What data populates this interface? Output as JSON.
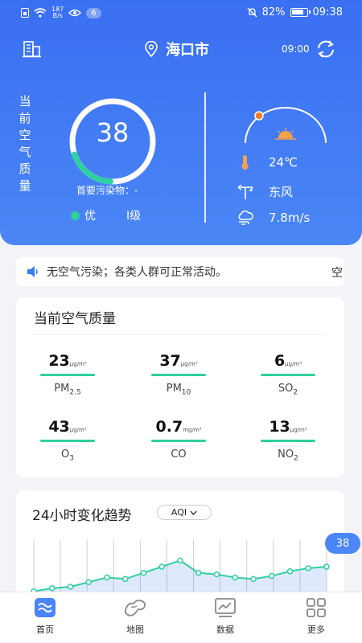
{
  "status_bar": {
    "speed_top": "187",
    "speed_bottom": "B/s",
    "notif_count": "6",
    "battery": "82%",
    "time": "09:38"
  },
  "header": {
    "city": "海口市",
    "update_time": "09:00"
  },
  "aqi": {
    "label_chars": [
      "当",
      "前",
      "空",
      "气",
      "质",
      "量"
    ],
    "value": "38",
    "progress": 0.19,
    "primary_pollutant": "首要污染物：-",
    "level_name": "优",
    "level_grade": "I级"
  },
  "weather": {
    "temperature": "24℃",
    "wind_direction": "东风",
    "wind_speed": "7.8m/s"
  },
  "notice": {
    "text": "无空气污染；各类人群可正常活动。",
    "tail": "空"
  },
  "current_card": {
    "title": "当前空气质量",
    "metrics": [
      {
        "value": "23",
        "unit": "μg/m³",
        "name": "PM",
        "sub": "2.5"
      },
      {
        "value": "37",
        "unit": "μg/m³",
        "name": "PM",
        "sub": "10"
      },
      {
        "value": "6",
        "unit": "μg/m³",
        "name": "SO",
        "sub": "2"
      },
      {
        "value": "43",
        "unit": "μg/m³",
        "name": "O",
        "sub": "3"
      },
      {
        "value": "0.7",
        "unit": "mg/m³",
        "name": "CO",
        "sub": ""
      },
      {
        "value": "13",
        "unit": "μg/m³",
        "name": "NO",
        "sub": "2"
      }
    ]
  },
  "trend_card": {
    "title": "24小时变化趋势",
    "selector": "AQI",
    "latest_value": "38"
  },
  "chart_data": {
    "type": "line",
    "values": [
      22,
      24,
      25,
      28,
      31,
      30,
      34,
      38,
      42,
      34,
      33,
      31,
      30,
      32,
      35,
      37,
      38
    ]
  },
  "bottom_nav": [
    {
      "label": "首页",
      "icon": "home-waves-icon"
    },
    {
      "label": "地图",
      "icon": "map-icon"
    },
    {
      "label": "数据",
      "icon": "chart-icon"
    },
    {
      "label": "更多",
      "icon": "grid-icon"
    }
  ],
  "colors": {
    "primary": "#3a6ff2",
    "good": "#2ed0a0",
    "sun": "#f07a30"
  }
}
